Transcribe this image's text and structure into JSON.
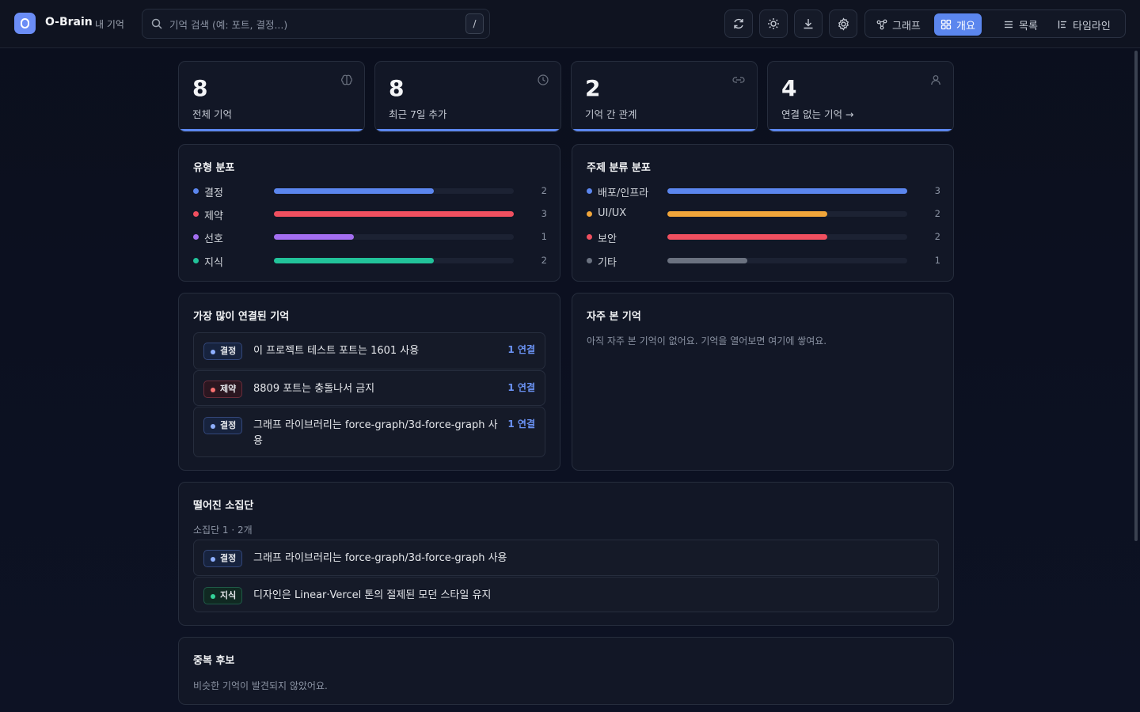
{
  "header": {
    "brand": "O-Brain",
    "brand_sub": "내 기억",
    "logo_letter": "O",
    "search_placeholder": "기억 검색 (예: 포트, 결정...)",
    "search_shortcut": "/",
    "icons": [
      "refresh-icon",
      "sun-icon",
      "download-icon",
      "gear-icon"
    ],
    "views": [
      {
        "label": "그래프",
        "icon": "graph-icon",
        "active": false
      },
      {
        "label": "개요",
        "icon": "grid-icon",
        "active": true
      },
      {
        "label": "목록",
        "icon": "list-icon",
        "active": false
      },
      {
        "label": "타임라인",
        "icon": "timeline-icon",
        "active": false
      }
    ]
  },
  "stats": [
    {
      "value": "8",
      "label": "전체 기억",
      "icon": "brain-icon"
    },
    {
      "value": "8",
      "label": "최근 7일 추가",
      "icon": "clock-icon"
    },
    {
      "value": "2",
      "label": "기억 간 관계",
      "icon": "link-icon"
    },
    {
      "value": "4",
      "label": "연결 없는 기억 →",
      "icon": "user-icon"
    }
  ],
  "type_distribution": {
    "title": "유형 분포",
    "max": 3,
    "rows": [
      {
        "name": "결정",
        "count": 2,
        "color": "#5b86ee"
      },
      {
        "name": "제약",
        "count": 3,
        "color": "#ef4f5f"
      },
      {
        "name": "선호",
        "count": 1,
        "color": "#a36ef0"
      },
      {
        "name": "지식",
        "count": 2,
        "color": "#22c39a"
      }
    ]
  },
  "topic_distribution": {
    "title": "주제 분류 분포",
    "max": 3,
    "rows": [
      {
        "name": "배포/인프라",
        "count": 3,
        "color": "#5b86ee"
      },
      {
        "name": "UI/UX",
        "count": 2,
        "color": "#f0a53a"
      },
      {
        "name": "보안",
        "count": 2,
        "color": "#ef4f5f"
      },
      {
        "name": "기타",
        "count": 1,
        "color": "#6b7280"
      }
    ]
  },
  "most_connected": {
    "title": "가장 많이 연결된 기억",
    "items": [
      {
        "type": "결정",
        "kind": "decision",
        "text": "이 프로젝트 테스트 포트는 1601 사용",
        "links": "1 연결"
      },
      {
        "type": "제약",
        "kind": "constraint",
        "text": "8809 포트는 충돌나서 금지",
        "links": "1 연결"
      },
      {
        "type": "결정",
        "kind": "decision",
        "text": "그래프 라이브러리는 force-graph/3d-force-graph 사용",
        "links": "1 연결"
      }
    ]
  },
  "frequently_viewed": {
    "title": "자주 본 기억",
    "empty": "아직 자주 본 기억이 없어요. 기억을 열어보면 여기에 쌓여요."
  },
  "islands": {
    "title": "떨어진 소집단",
    "subtitle": "소집단 1 · 2개",
    "items": [
      {
        "type": "결정",
        "kind": "decision",
        "text": "그래프 라이브러리는 force-graph/3d-force-graph 사용"
      },
      {
        "type": "지식",
        "kind": "knowledge",
        "text": "디자인은 Linear·Vercel 톤의 절제된 모던 스타일 유지"
      }
    ]
  },
  "duplicates": {
    "title": "중복 후보",
    "empty": "비슷한 기억이 발견되지 않았어요."
  }
}
